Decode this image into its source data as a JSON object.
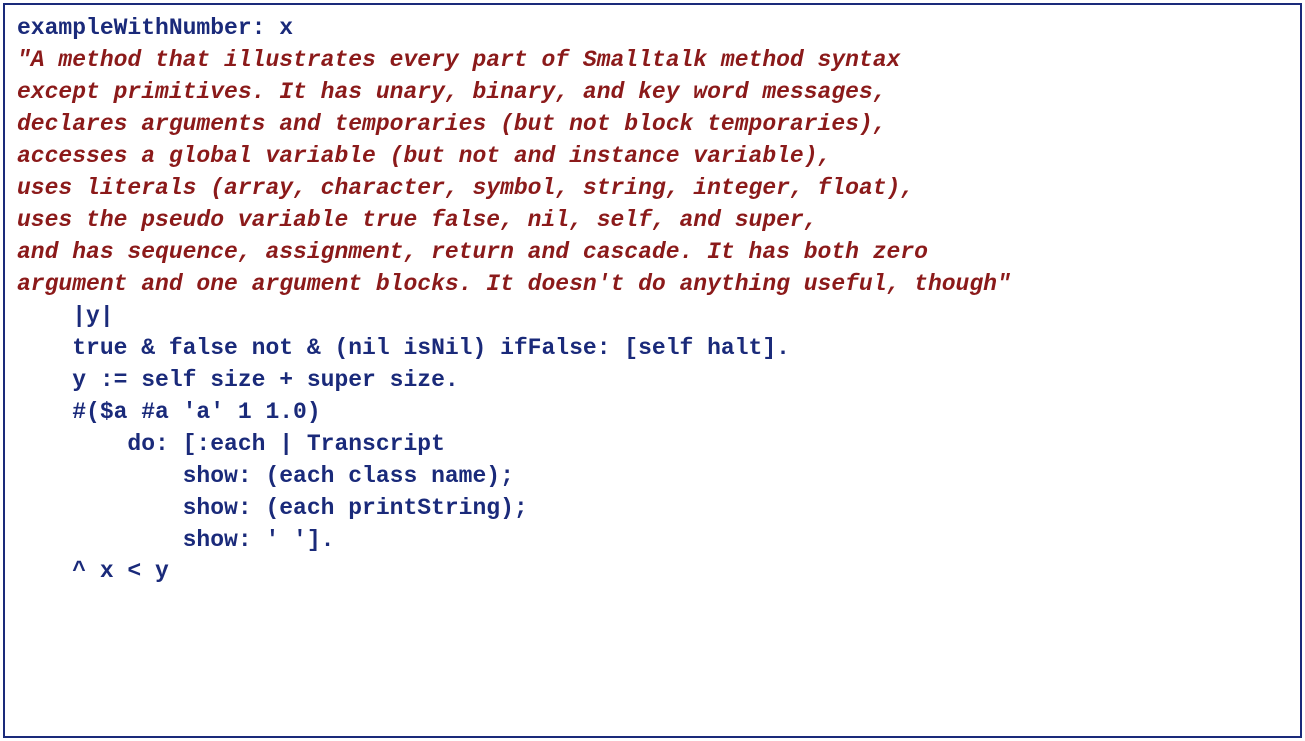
{
  "colors": {
    "border": "#1a2a7a",
    "comment": "#8b1a1a",
    "code": "#1a2a7a"
  },
  "method_selector": "exampleWithNumber: x",
  "comment_lines": [
    "\"A method that illustrates every part of Smalltalk method syntax",
    "except primitives. It has unary, binary, and key word messages,",
    "declares arguments and temporaries (but not block temporaries),",
    "accesses a global variable (but not and instance variable),",
    "uses literals (array, character, symbol, string, integer, float),",
    "uses the pseudo variable true false, nil, self, and super,",
    "and has sequence, assignment, return and cascade. It has both zero",
    "argument and one argument blocks. It doesn't do anything useful, though\""
  ],
  "code_lines": [
    "    |y|",
    "    true & false not & (nil isNil) ifFalse: [self halt].",
    "    y := self size + super size.",
    "    #($a #a 'a' 1 1.0)",
    "        do: [:each | Transcript",
    "            show: (each class name);",
    "            show: (each printString);",
    "            show: ' '].",
    "    ^ x < y"
  ]
}
